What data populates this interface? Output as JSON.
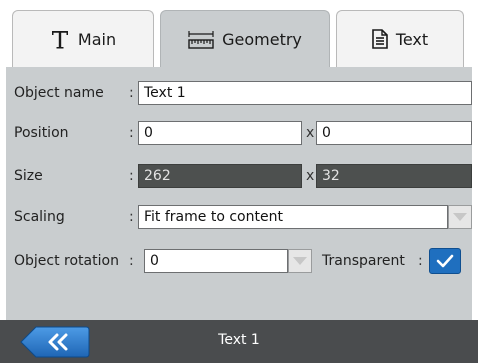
{
  "tabs": [
    {
      "label": "Main",
      "icon": "text-tool-icon"
    },
    {
      "label": "Geometry",
      "icon": "ruler-icon"
    },
    {
      "label": "Text",
      "icon": "document-icon"
    }
  ],
  "active_tab": "Geometry",
  "form": {
    "object_name": {
      "label": "Object name",
      "value": "Text 1"
    },
    "position": {
      "label": "Position",
      "x": "0",
      "y": "0",
      "separator": "x"
    },
    "size": {
      "label": "Size",
      "width": "262",
      "height": "32",
      "separator": "x"
    },
    "scaling": {
      "label": "Scaling",
      "value": "Fit frame to content"
    },
    "rotation": {
      "label": "Object rotation",
      "value": "0"
    },
    "transparent": {
      "label": "Transparent",
      "checked": true
    },
    "colon": ":"
  },
  "footer": {
    "title": "Text 1",
    "back_icon": "double-chevron-left-icon"
  },
  "colors": {
    "accent": "#1f6fbf",
    "panel": "#c9cdcf",
    "readonly": "#4d504f",
    "footer": "#4a4c4e"
  }
}
